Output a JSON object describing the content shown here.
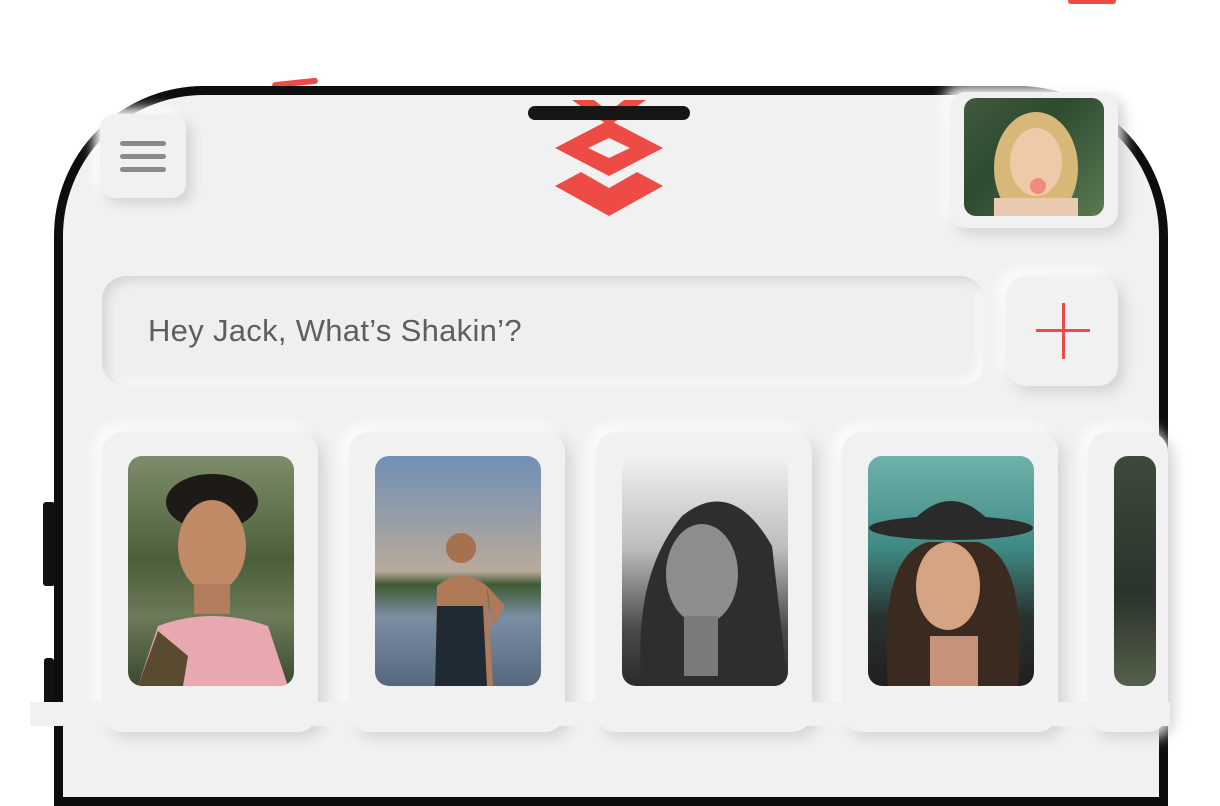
{
  "search": {
    "prompt": "Hey Jack, What’s Shakin’?"
  },
  "icons": {
    "menu": "hamburger-menu-icon",
    "add": "plus-icon",
    "logo": "app-logo"
  },
  "colors": {
    "accent": "#ef4b45",
    "background": "#f1f1f1",
    "frame": "#0d0d0d"
  },
  "stories": [
    {
      "id": 1
    },
    {
      "id": 2
    },
    {
      "id": 3
    },
    {
      "id": 4
    },
    {
      "id": 5
    }
  ]
}
